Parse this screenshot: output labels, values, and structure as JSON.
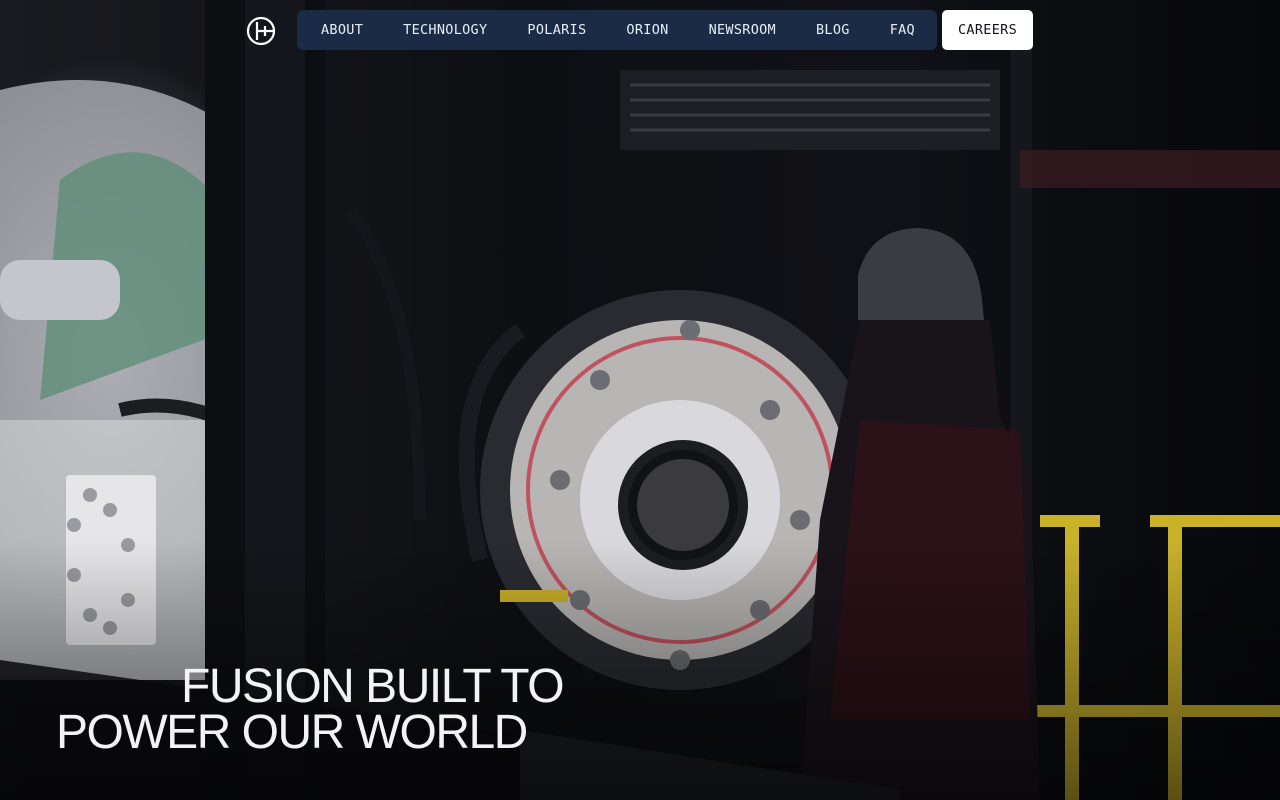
{
  "nav": {
    "items": [
      {
        "label": "ABOUT"
      },
      {
        "label": "TECHNOLOGY"
      },
      {
        "label": "POLARIS"
      },
      {
        "label": "ORION"
      },
      {
        "label": "NEWSROOM"
      },
      {
        "label": "BLOG"
      },
      {
        "label": "FAQ"
      }
    ],
    "cta_label": "CAREERS"
  },
  "hero": {
    "headline_line1": "FUSION BUILT TO",
    "headline_line2": "POWER OUR WORLD"
  },
  "colors": {
    "nav_bg": "#1c2d4a",
    "cta_bg": "#ffffff",
    "text": "#f3f3f3"
  },
  "icons": {
    "logo": "helion-logo-icon"
  }
}
